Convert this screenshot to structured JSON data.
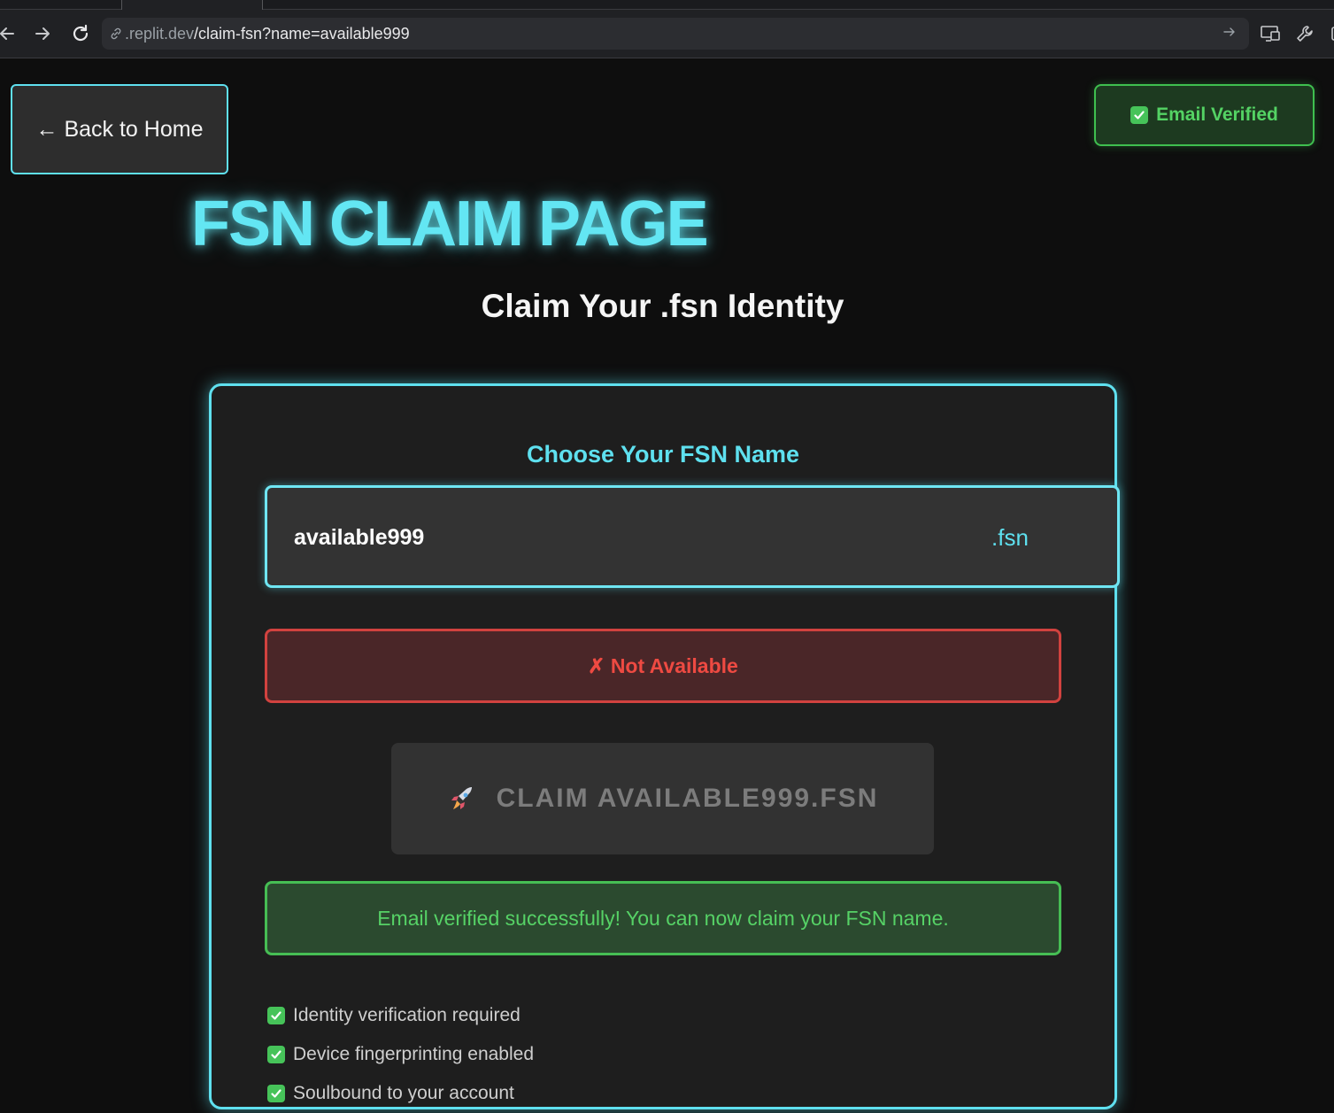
{
  "browser": {
    "url_host": ".replit.dev",
    "url_path": "/claim-fsn?name=available999"
  },
  "header": {
    "back_label": "← Back to Home",
    "verified_label": "Email Verified"
  },
  "main": {
    "title": "FSN CLAIM PAGE",
    "subtitle": "Claim Your .fsn Identity"
  },
  "form": {
    "choose_label": "Choose Your FSN Name",
    "name_value": "available999",
    "suffix": ".fsn",
    "availability_status": "✗ Not Available",
    "claim_emoji": "🚀",
    "claim_label": "CLAIM AVAILABLE999.FSN",
    "success_message": "Email verified successfully! You can now claim your FSN name."
  },
  "features": [
    "Identity verification required",
    "Device fingerprinting enabled",
    "Soulbound to your account"
  ],
  "icons": {
    "back": "back-arrow-icon",
    "forward": "forward-arrow-icon",
    "reload": "reload-icon",
    "link": "link-icon",
    "go": "go-arrow-icon",
    "cast": "cast-screen-icon",
    "tools": "wrench-icon",
    "check": "checkmark-icon",
    "rocket": "rocket-icon"
  },
  "colors": {
    "accent": "#5fe0ef",
    "success": "#46be54",
    "error": "#d1423f"
  }
}
